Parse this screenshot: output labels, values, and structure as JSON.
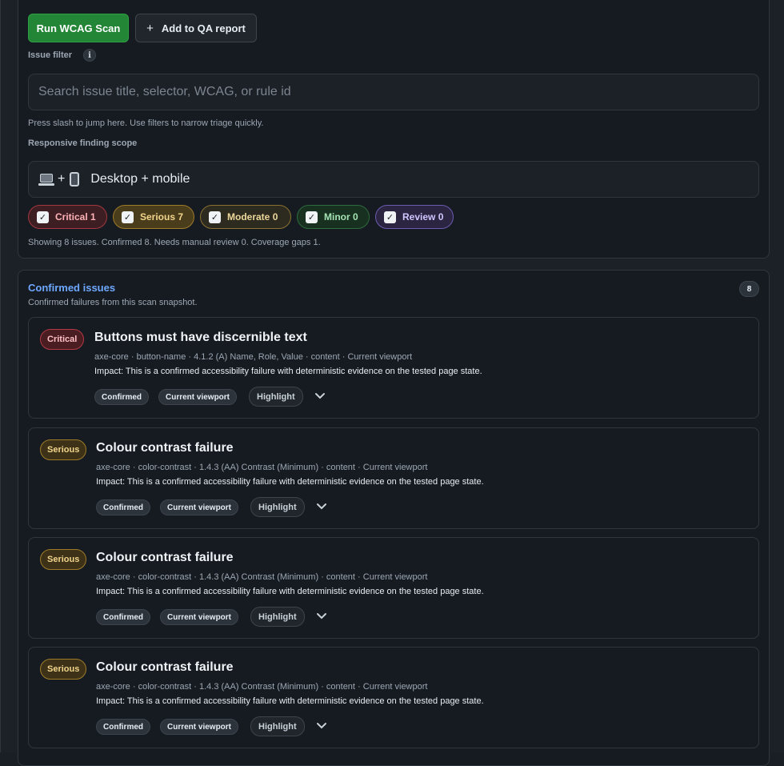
{
  "toolbar": {
    "run_label": "Run WCAG Scan",
    "add_label": "Add to QA report"
  },
  "filter": {
    "label": "Issue filter",
    "placeholder": "Search issue title, selector, WCAG, or rule id",
    "value": "",
    "hint": "Press slash to jump here. Use filters to narrow triage quickly."
  },
  "scope": {
    "label": "Responsive finding scope",
    "selected": "Desktop + mobile"
  },
  "severity_filters": [
    {
      "label": "Critical",
      "count": "1",
      "checked": true
    },
    {
      "label": "Serious",
      "count": "7",
      "checked": true
    },
    {
      "label": "Moderate",
      "count": "0",
      "checked": true
    },
    {
      "label": "Minor",
      "count": "0",
      "checked": true
    },
    {
      "label": "Review",
      "count": "0",
      "checked": true
    }
  ],
  "summary": "Showing 8 issues. Confirmed 8. Needs manual review 0. Coverage gaps 1.",
  "confirmed": {
    "title": "Confirmed issues",
    "subtitle": "Confirmed failures from this scan snapshot.",
    "count": "8",
    "issues": [
      {
        "severity": "Critical",
        "title": "Buttons must have discernible text",
        "meta": "axe-core · button-name · 4.1.2 (A) Name, Role, Value · content · Current viewport",
        "impact": "Impact: This is a confirmed accessibility failure with deterministic evidence on the tested page state.",
        "status": "Confirmed",
        "viewport": "Current viewport",
        "action": "Highlight"
      },
      {
        "severity": "Serious",
        "title": "Colour contrast failure",
        "meta": "axe-core · color-contrast · 1.4.3 (AA) Contrast (Minimum) · content · Current viewport",
        "impact": "Impact: This is a confirmed accessibility failure with deterministic evidence on the tested page state.",
        "status": "Confirmed",
        "viewport": "Current viewport",
        "action": "Highlight"
      },
      {
        "severity": "Serious",
        "title": "Colour contrast failure",
        "meta": "axe-core · color-contrast · 1.4.3 (AA) Contrast (Minimum) · content · Current viewport",
        "impact": "Impact: This is a confirmed accessibility failure with deterministic evidence on the tested page state.",
        "status": "Confirmed",
        "viewport": "Current viewport",
        "action": "Highlight"
      },
      {
        "severity": "Serious",
        "title": "Colour contrast failure",
        "meta": "axe-core · color-contrast · 1.4.3 (AA) Contrast (Minimum) · content · Current viewport",
        "impact": "Impact: This is a confirmed accessibility failure with deterministic evidence on the tested page state.",
        "status": "Confirmed",
        "viewport": "Current viewport",
        "action": "Highlight"
      }
    ]
  },
  "colors": {
    "run_button": "#238636",
    "accent_title": "#6ea8fe",
    "critical": "#b13a44",
    "serious": "#9e7b28",
    "minor": "#2e6b3e",
    "review": "#6a5bb0"
  }
}
